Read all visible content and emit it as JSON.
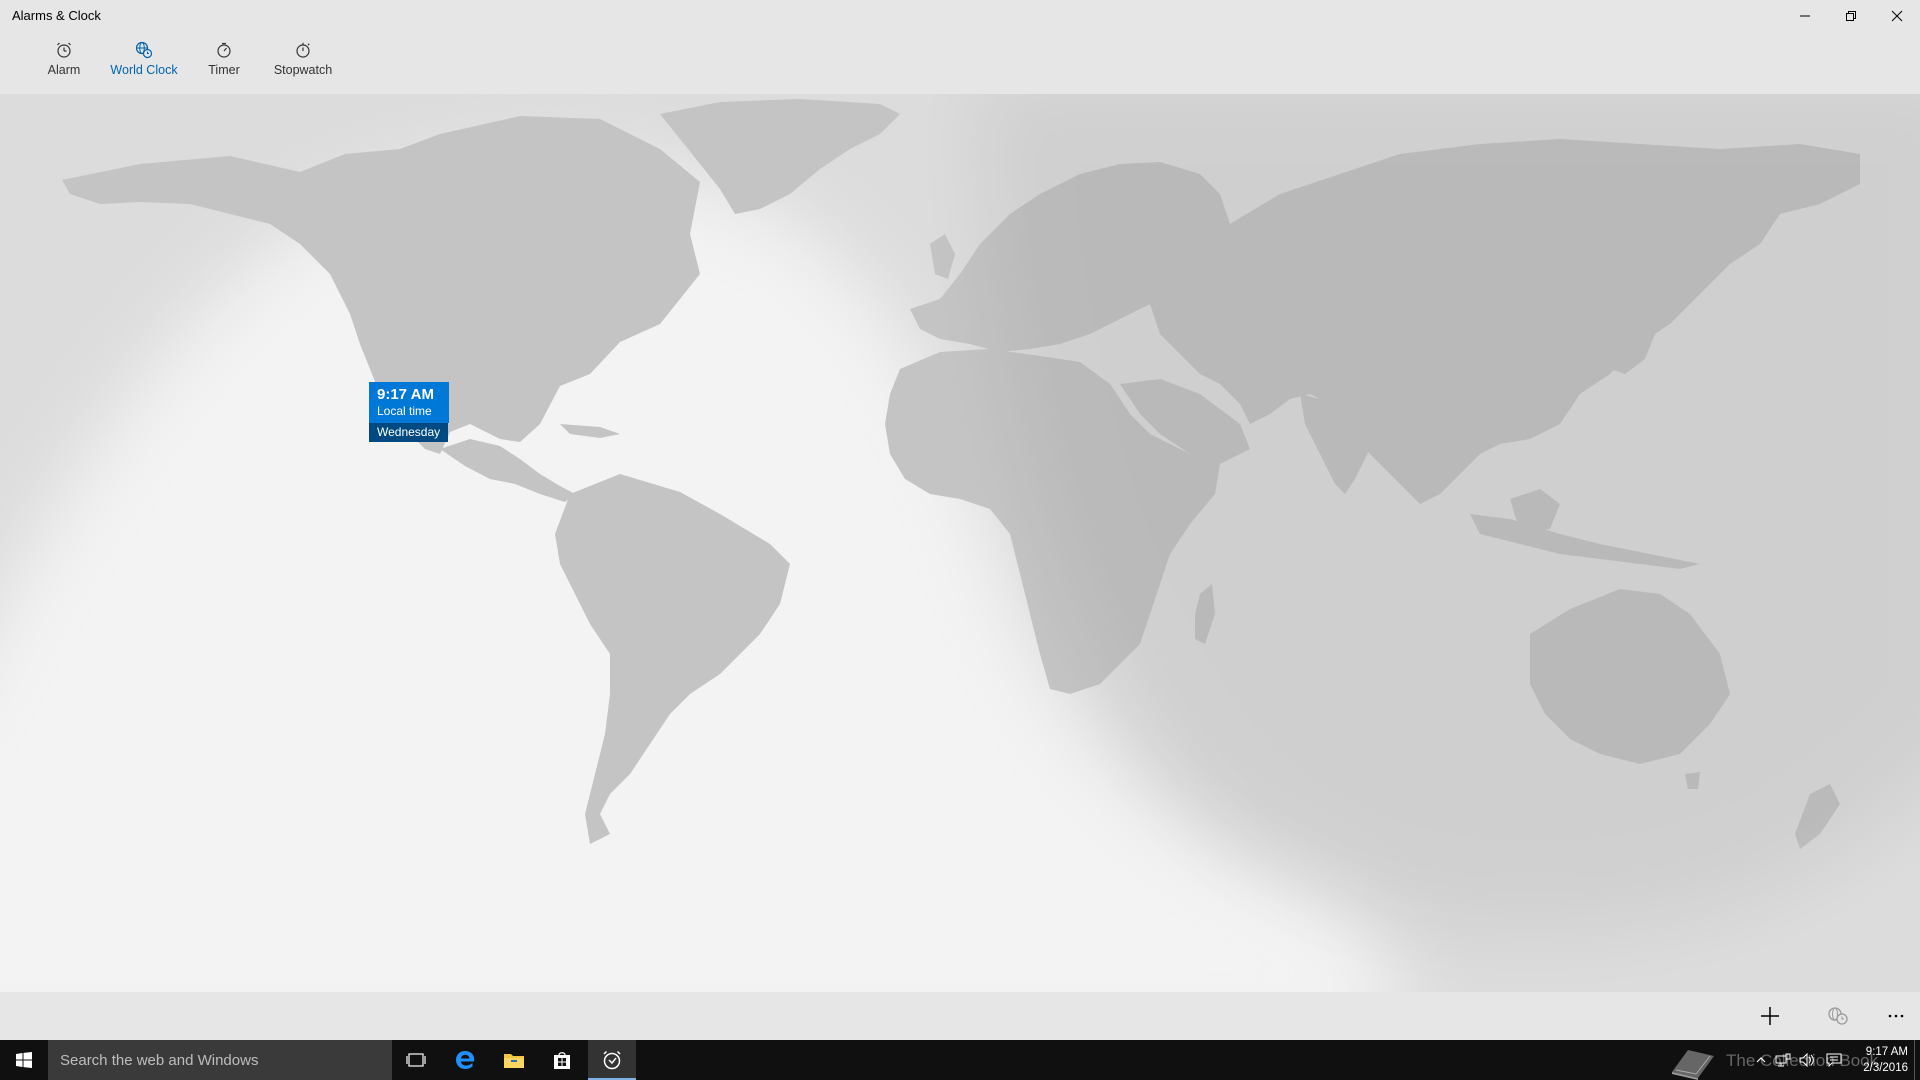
{
  "window": {
    "title": "Alarms & Clock",
    "controls": [
      "minimize-icon",
      "restore-icon",
      "close-icon"
    ]
  },
  "tabs": [
    {
      "label": "Alarm",
      "icon": "alarm-clock-icon",
      "active": false
    },
    {
      "label": "World Clock",
      "icon": "world-clock-icon",
      "active": true
    },
    {
      "label": "Timer",
      "icon": "timer-icon",
      "active": false
    },
    {
      "label": "Stopwatch",
      "icon": "stopwatch-icon",
      "active": false
    }
  ],
  "map": {
    "local_marker": {
      "time": "9:17 AM",
      "label": "Local time",
      "day": "Wednesday"
    }
  },
  "commandbar": {
    "buttons": [
      "add-icon",
      "compare-clocks-icon",
      "more-icon"
    ]
  },
  "taskbar": {
    "search_placeholder": "Search the web and Windows",
    "pinned": [
      "task-view-icon",
      "edge-icon",
      "file-explorer-icon",
      "store-icon",
      "alarms-clock-app-icon"
    ],
    "watermark": "The Collection Book",
    "clock_time": "9:17 AM",
    "clock_date": "2/3/2016"
  },
  "colors": {
    "accent": "#0078d7",
    "accent_dark": "#004a83",
    "active_tab": "#0063b1",
    "land": "#c4c4c4",
    "night": "#dcdcdc",
    "day": "#f2f2f2",
    "taskbar": "#101010"
  }
}
